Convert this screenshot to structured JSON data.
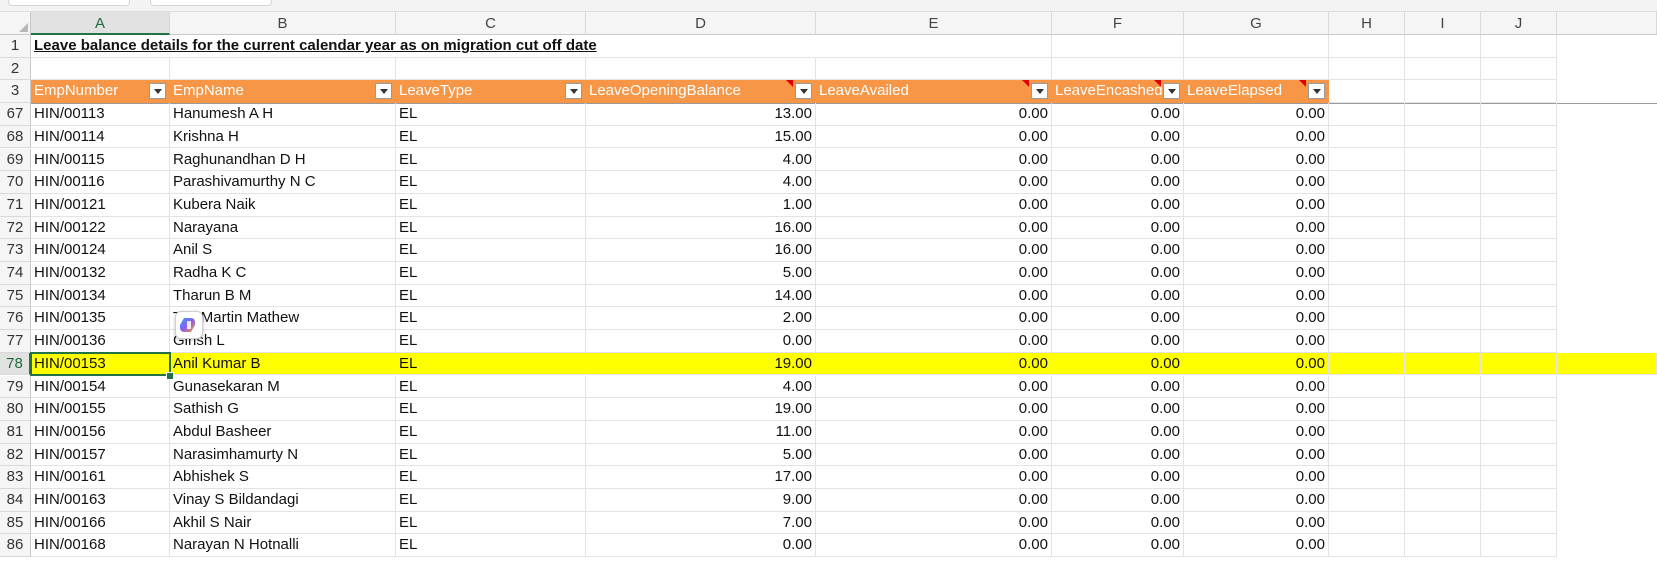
{
  "column_headers": [
    "A",
    "B",
    "C",
    "D",
    "E",
    "F",
    "G",
    "H",
    "I",
    "J"
  ],
  "selected_column": "A",
  "selected_row": "78",
  "title_row": {
    "row": "1",
    "text": "Leave balance details for the current calendar year as on migration cut off date"
  },
  "empty_row": {
    "row": "2"
  },
  "table_header": {
    "row": "3",
    "columns": [
      "EmpNumber",
      "EmpName",
      "LeaveType",
      "LeaveOpeningBalance",
      "LeaveAvailed",
      "LeaveEncashed",
      "LeaveElapsed"
    ],
    "comment_markers_on": [
      "LeaveOpeningBalance",
      "LeaveAvailed",
      "LeaveEncashed",
      "LeaveElapsed"
    ]
  },
  "rows": [
    {
      "row": "67",
      "emp_number": "HIN/00113",
      "emp_name": "Hanumesh A H",
      "leave_type": "EL",
      "opening": "13.00",
      "availed": "0.00",
      "encashed": "0.00",
      "elapsed": "0.00"
    },
    {
      "row": "68",
      "emp_number": "HIN/00114",
      "emp_name": "Krishna H",
      "leave_type": "EL",
      "opening": "15.00",
      "availed": "0.00",
      "encashed": "0.00",
      "elapsed": "0.00"
    },
    {
      "row": "69",
      "emp_number": "HIN/00115",
      "emp_name": "Raghunandhan D H",
      "leave_type": "EL",
      "opening": "4.00",
      "availed": "0.00",
      "encashed": "0.00",
      "elapsed": "0.00"
    },
    {
      "row": "70",
      "emp_number": "HIN/00116",
      "emp_name": "Parashivamurthy N C",
      "leave_type": "EL",
      "opening": "4.00",
      "availed": "0.00",
      "encashed": "0.00",
      "elapsed": "0.00"
    },
    {
      "row": "71",
      "emp_number": "HIN/00121",
      "emp_name": "Kubera Naik",
      "leave_type": "EL",
      "opening": "1.00",
      "availed": "0.00",
      "encashed": "0.00",
      "elapsed": "0.00"
    },
    {
      "row": "72",
      "emp_number": "HIN/00122",
      "emp_name": "Narayana",
      "leave_type": "EL",
      "opening": "16.00",
      "availed": "0.00",
      "encashed": "0.00",
      "elapsed": "0.00"
    },
    {
      "row": "73",
      "emp_number": "HIN/00124",
      "emp_name": "Anil S",
      "leave_type": "EL",
      "opening": "16.00",
      "availed": "0.00",
      "encashed": "0.00",
      "elapsed": "0.00"
    },
    {
      "row": "74",
      "emp_number": "HIN/00132",
      "emp_name": "Radha K C",
      "leave_type": "EL",
      "opening": "5.00",
      "availed": "0.00",
      "encashed": "0.00",
      "elapsed": "0.00"
    },
    {
      "row": "75",
      "emp_number": "HIN/00134",
      "emp_name": "Tharun B M",
      "leave_type": "EL",
      "opening": "14.00",
      "availed": "0.00",
      "encashed": "0.00",
      "elapsed": "0.00"
    },
    {
      "row": "76",
      "emp_number": "HIN/00135",
      "emp_name": "Tiju Martin Mathew",
      "leave_type": "EL",
      "opening": "2.00",
      "availed": "0.00",
      "encashed": "0.00",
      "elapsed": "0.00"
    },
    {
      "row": "77",
      "emp_number": "HIN/00136",
      "emp_name": "Girish L",
      "leave_type": "EL",
      "opening": "0.00",
      "availed": "0.00",
      "encashed": "0.00",
      "elapsed": "0.00"
    },
    {
      "row": "78",
      "emp_number": "HIN/00153",
      "emp_name": "Anil Kumar B",
      "leave_type": "EL",
      "opening": "19.00",
      "availed": "0.00",
      "encashed": "0.00",
      "elapsed": "0.00",
      "highlighted": true
    },
    {
      "row": "79",
      "emp_number": "HIN/00154",
      "emp_name": "Gunasekaran M",
      "leave_type": "EL",
      "opening": "4.00",
      "availed": "0.00",
      "encashed": "0.00",
      "elapsed": "0.00"
    },
    {
      "row": "80",
      "emp_number": "HIN/00155",
      "emp_name": "Sathish G",
      "leave_type": "EL",
      "opening": "19.00",
      "availed": "0.00",
      "encashed": "0.00",
      "elapsed": "0.00"
    },
    {
      "row": "81",
      "emp_number": "HIN/00156",
      "emp_name": "Abdul Basheer",
      "leave_type": "EL",
      "opening": "11.00",
      "availed": "0.00",
      "encashed": "0.00",
      "elapsed": "0.00"
    },
    {
      "row": "82",
      "emp_number": "HIN/00157",
      "emp_name": "Narasimhamurty N",
      "leave_type": "EL",
      "opening": "5.00",
      "availed": "0.00",
      "encashed": "0.00",
      "elapsed": "0.00"
    },
    {
      "row": "83",
      "emp_number": "HIN/00161",
      "emp_name": "Abhishek S",
      "leave_type": "EL",
      "opening": "17.00",
      "availed": "0.00",
      "encashed": "0.00",
      "elapsed": "0.00"
    },
    {
      "row": "84",
      "emp_number": "HIN/00163",
      "emp_name": "Vinay S Bildandagi",
      "leave_type": "EL",
      "opening": "9.00",
      "availed": "0.00",
      "encashed": "0.00",
      "elapsed": "0.00"
    },
    {
      "row": "85",
      "emp_number": "HIN/00166",
      "emp_name": "Akhil S Nair",
      "leave_type": "EL",
      "opening": "7.00",
      "availed": "0.00",
      "encashed": "0.00",
      "elapsed": "0.00"
    },
    {
      "row": "86",
      "emp_number": "HIN/00168",
      "emp_name": "Narayan N Hotnalli",
      "leave_type": "EL",
      "opening": "0.00",
      "availed": "0.00",
      "encashed": "0.00",
      "elapsed": "0.00"
    }
  ],
  "floating_icon": "copilot-icon",
  "colors": {
    "table_header_bg": "#f79646",
    "highlight_row": "#ffff00",
    "selection": "#217346",
    "comment_marker": "#e00000"
  }
}
